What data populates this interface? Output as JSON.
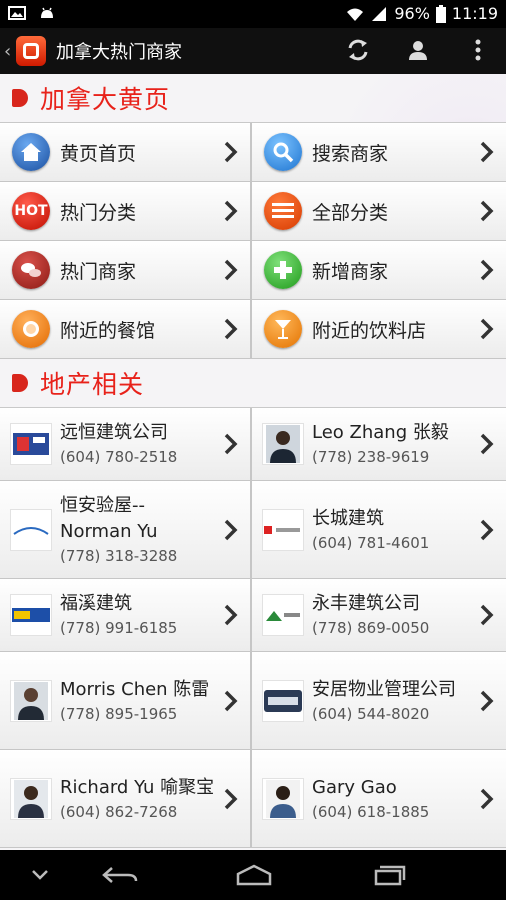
{
  "status_bar": {
    "battery": "96%",
    "time": "11:19"
  },
  "action_bar": {
    "title": "加拿大热门商家",
    "up_glyph": "‹"
  },
  "sections": [
    {
      "title": "加拿大黄页"
    },
    {
      "title": "地产相关"
    }
  ],
  "menu": [
    {
      "label": "黄页首页",
      "icon": "home-icon"
    },
    {
      "label": "搜索商家",
      "icon": "search-icon"
    },
    {
      "label": "热门分类",
      "icon": "hot-icon",
      "icon_text": "HOT"
    },
    {
      "label": "全部分类",
      "icon": "list-icon"
    },
    {
      "label": "热门商家",
      "icon": "chat-icon"
    },
    {
      "label": "新增商家",
      "icon": "add-icon"
    },
    {
      "label": "附近的餐馆",
      "icon": "restaurant-icon"
    },
    {
      "label": "附近的饮料店",
      "icon": "drink-icon"
    }
  ],
  "businesses": [
    {
      "name": "远恒建筑公司",
      "phone": "(604) 780-2518"
    },
    {
      "name": "Leo Zhang 张毅",
      "phone": "(778) 238-9619"
    },
    {
      "name": "恒安验屋--Norman Yu",
      "phone": "(778) 318-3288"
    },
    {
      "name": "长城建筑",
      "phone": "(604) 781-4601"
    },
    {
      "name": "福溪建筑",
      "phone": "(778) 991-6185"
    },
    {
      "name": "永丰建筑公司",
      "phone": "(778) 869-0050"
    },
    {
      "name": "Morris Chen 陈雷",
      "phone": "(778) 895-1965"
    },
    {
      "name": "安居物业管理公司",
      "phone": "(604) 544-8020"
    },
    {
      "name": "Richard Yu 喻聚宝",
      "phone": "(604) 862-7268"
    },
    {
      "name": "Gary Gao",
      "phone": "(604) 618-1885"
    }
  ],
  "colors": {
    "accent": "#e8221a",
    "action_bar": "#101010"
  }
}
